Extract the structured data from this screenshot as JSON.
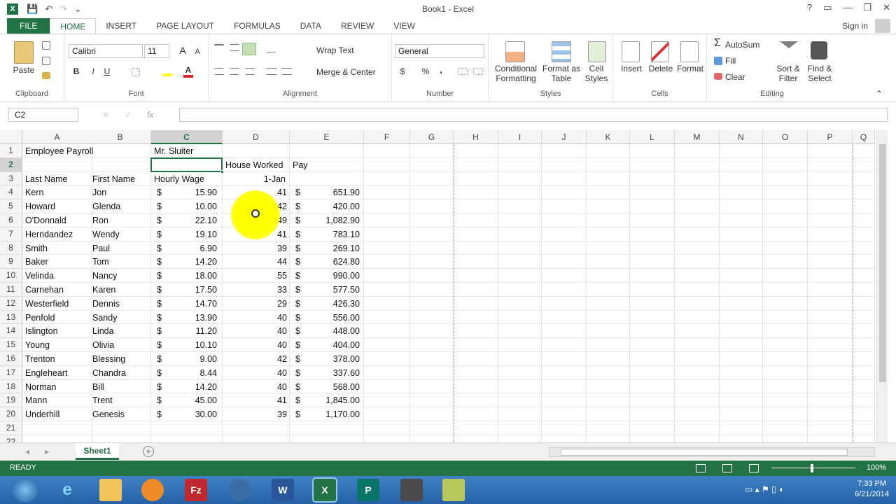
{
  "titlebar": {
    "title": "Book1 - Excel",
    "app_icon": "X",
    "help": "?",
    "ribbon_display": "▭",
    "minimize": "—",
    "maximize": "❐",
    "close": "✕",
    "save_icon": "💾",
    "undo_icon": "↶",
    "redo_icon": "↷",
    "customize_icon": "⌄"
  },
  "tabs": [
    "FILE",
    "HOME",
    "INSERT",
    "PAGE LAYOUT",
    "FORMULAS",
    "DATA",
    "REVIEW",
    "VIEW"
  ],
  "signin": "Sign in",
  "ribbon": {
    "clipboard": {
      "label": "Clipboard",
      "paste": "Paste"
    },
    "font": {
      "label": "Font",
      "font_name": "Calibri",
      "font_size": "11",
      "bold": "B",
      "italic": "I",
      "underline": "U",
      "grow": "A",
      "shrink": "A"
    },
    "alignment": {
      "label": "Alignment",
      "wrap_text": "Wrap Text",
      "merge_center": "Merge & Center"
    },
    "number": {
      "label": "Number",
      "format": "General",
      "currency": "$",
      "percent": "%",
      "comma": ","
    },
    "styles": {
      "label": "Styles",
      "conditional_formatting": "Conditional Formatting",
      "format_as_table": "Format as Table",
      "cell_styles": "Cell Styles"
    },
    "cells": {
      "label": "Cells",
      "insert": "Insert",
      "delete": "Delete",
      "format": "Format"
    },
    "editing": {
      "label": "Editing",
      "autosum": "AutoSum",
      "fill": "Fill",
      "clear": "Clear",
      "sort_filter": "Sort & Filter",
      "find_select": "Find & Select"
    }
  },
  "formula_bar": {
    "name_box": "C2",
    "fx": "fx",
    "value": ""
  },
  "columns": [
    "A",
    "B",
    "C",
    "D",
    "E",
    "F",
    "G",
    "H",
    "I",
    "J",
    "K",
    "L",
    "M",
    "N",
    "O",
    "P",
    "Q"
  ],
  "rows": [
    "1",
    "2",
    "3",
    "4",
    "5",
    "6",
    "7",
    "8",
    "9",
    "10",
    "11",
    "12",
    "13",
    "14",
    "15",
    "16",
    "17",
    "18",
    "19",
    "20",
    "21",
    "22"
  ],
  "sheet": {
    "r1": {
      "a": "Employee Payroll",
      "c": "Mr. Sluiter"
    },
    "r2": {
      "d": "House Worked",
      "e": "Pay"
    },
    "r3": {
      "a": "Last Name",
      "b": "First Name",
      "c": "Hourly Wage",
      "d": "1-Jan"
    },
    "currency_symbol": "$",
    "data": [
      {
        "last": "Kern",
        "first": "Jon",
        "wage": "15.90",
        "hours": "41",
        "pay": "651.90"
      },
      {
        "last": "Howard",
        "first": "Glenda",
        "wage": "10.00",
        "hours": "42",
        "pay": "420.00"
      },
      {
        "last": "O'Donnald",
        "first": "Ron",
        "wage": "22.10",
        "hours": "49",
        "pay": "1,082.90"
      },
      {
        "last": "Herndandez",
        "first": "Wendy",
        "wage": "19.10",
        "hours": "41",
        "pay": "783.10"
      },
      {
        "last": "Smith",
        "first": "Paul",
        "wage": "6.90",
        "hours": "39",
        "pay": "269.10"
      },
      {
        "last": "Baker",
        "first": "Tom",
        "wage": "14.20",
        "hours": "44",
        "pay": "624.80"
      },
      {
        "last": "Velinda",
        "first": "Nancy",
        "wage": "18.00",
        "hours": "55",
        "pay": "990.00"
      },
      {
        "last": "Carnehan",
        "first": "Karen",
        "wage": "17.50",
        "hours": "33",
        "pay": "577.50"
      },
      {
        "last": "Westerfield",
        "first": "Dennis",
        "wage": "14.70",
        "hours": "29",
        "pay": "426.30"
      },
      {
        "last": "Penfold",
        "first": "Sandy",
        "wage": "13.90",
        "hours": "40",
        "pay": "556.00"
      },
      {
        "last": "Islington",
        "first": "Linda",
        "wage": "11.20",
        "hours": "40",
        "pay": "448.00"
      },
      {
        "last": "Young",
        "first": "Olivia",
        "wage": "10.10",
        "hours": "40",
        "pay": "404.00"
      },
      {
        "last": "Trenton",
        "first": "Blessing",
        "wage": "9.00",
        "hours": "42",
        "pay": "378.00"
      },
      {
        "last": "Engleheart",
        "first": "Chandra",
        "wage": "8.44",
        "hours": "40",
        "pay": "337.60"
      },
      {
        "last": "Norman",
        "first": "Bill",
        "wage": "14.20",
        "hours": "40",
        "pay": "568.00"
      },
      {
        "last": "Mann",
        "first": "Trent",
        "wage": "45.00",
        "hours": "41",
        "pay": "1,845.00"
      },
      {
        "last": "Underhill",
        "first": "Genesis",
        "wage": "30.00",
        "hours": "39",
        "pay": "1,170.00"
      }
    ]
  },
  "selected_cell": "C2",
  "sheet_tabs": [
    "Sheet1"
  ],
  "status": {
    "mode": "READY",
    "zoom": "100%"
  },
  "clock": {
    "time": "7:33 PM",
    "date": "6/21/2014"
  },
  "colors": {
    "accent": "#217346",
    "highlight": "#ffff00"
  }
}
